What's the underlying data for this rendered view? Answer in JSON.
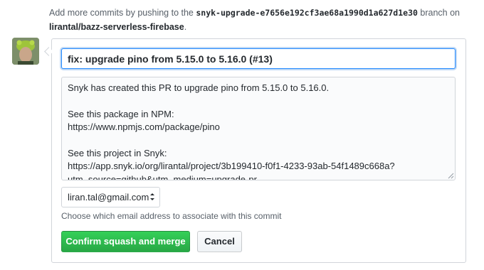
{
  "notice": {
    "prefix": "Add more commits by pushing to the ",
    "branch": "snyk-upgrade-e7656e192cf3ae68a1990d1a627d1e30",
    "middle": " branch on ",
    "repo": "lirantal/bazz-serverless-firebase",
    "suffix": "."
  },
  "avatar": {
    "alt": "avatar"
  },
  "commit": {
    "title": "fix: upgrade pino from 5.15.0 to 5.16.0 (#13)",
    "message": "Snyk has created this PR to upgrade pino from 5.15.0 to 5.16.0.\n\nSee this package in NPM:\nhttps://www.npmjs.com/package/pino\n\nSee this project in Snyk:\nhttps://app.snyk.io/org/lirantal/project/3b199410-f0f1-4233-93ab-54f1489c668a?utm_source=github&utm_medium=upgrade-pr"
  },
  "email": {
    "selected": "liran.tal@gmail.com",
    "hint": "Choose which email address to associate with this commit"
  },
  "buttons": {
    "confirm": "Confirm squash and merge",
    "cancel": "Cancel"
  },
  "colors": {
    "confirm_bg": "#28a745",
    "focus_border": "#2188ff",
    "muted_text": "#586069"
  }
}
